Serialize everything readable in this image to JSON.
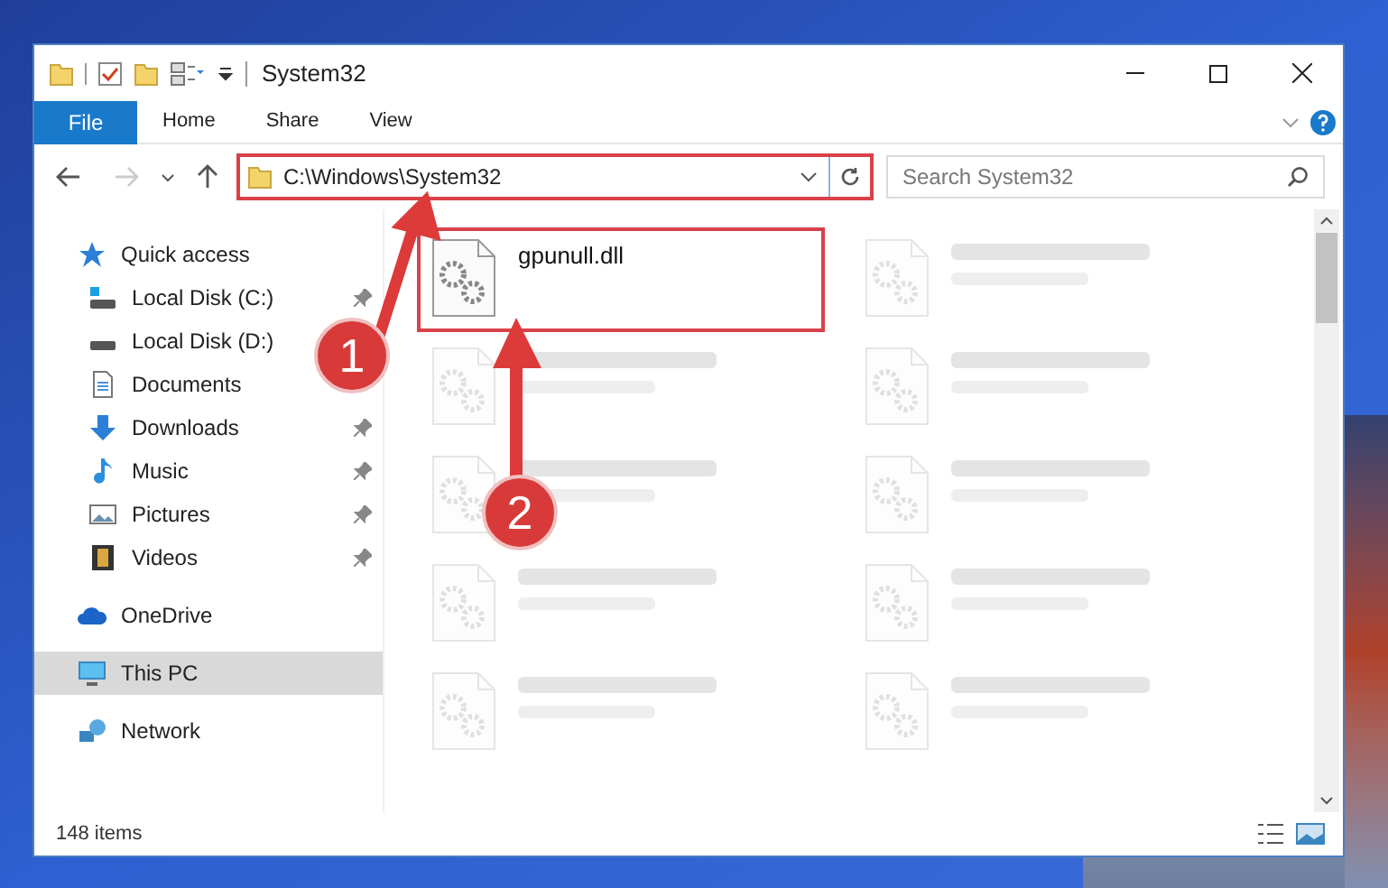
{
  "window": {
    "title": "System32"
  },
  "ribbon": {
    "tabs": [
      {
        "label": "File",
        "kind": "file"
      },
      {
        "label": "Home",
        "kind": "tab"
      },
      {
        "label": "Share",
        "kind": "tab"
      },
      {
        "label": "View",
        "kind": "tab"
      }
    ]
  },
  "address_bar": {
    "path": "C:\\Windows\\System32",
    "highlighted": true
  },
  "search": {
    "placeholder": "Search System32"
  },
  "sidebar": {
    "items": [
      {
        "label": "Quick access",
        "kind": "star",
        "selected": false,
        "children": [
          {
            "label": "Local Disk (C:)",
            "kind": "windows-drive",
            "pinned": true,
            "selected": false
          },
          {
            "label": "Local Disk (D:)",
            "kind": "drive",
            "pinned": false,
            "selected": false
          },
          {
            "label": "Documents",
            "kind": "documents",
            "pinned": false,
            "selected": false
          },
          {
            "label": "Downloads",
            "kind": "downloads",
            "pinned": true,
            "selected": false
          },
          {
            "label": "Music",
            "kind": "music",
            "pinned": true,
            "selected": false
          },
          {
            "label": "Pictures",
            "kind": "pictures",
            "pinned": true,
            "selected": false
          },
          {
            "label": "Videos",
            "kind": "videos",
            "pinned": true,
            "selected": false
          }
        ]
      },
      {
        "label": "OneDrive",
        "kind": "cloud",
        "selected": false
      },
      {
        "label": "This PC",
        "kind": "pc",
        "selected": true
      },
      {
        "label": "Network",
        "kind": "network",
        "selected": false
      }
    ]
  },
  "files": [
    {
      "kind": "file",
      "name": "gpunull.dll",
      "highlighted": true
    },
    {
      "kind": "blurred",
      "highlighted": false
    },
    {
      "kind": "blurred",
      "highlighted": false
    },
    {
      "kind": "blurred",
      "highlighted": false
    },
    {
      "kind": "blurred",
      "highlighted": false
    },
    {
      "kind": "blurred",
      "highlighted": false
    },
    {
      "kind": "blurred",
      "highlighted": false
    },
    {
      "kind": "blurred",
      "highlighted": false
    },
    {
      "kind": "blurred",
      "highlighted": false
    },
    {
      "kind": "blurred",
      "highlighted": false
    }
  ],
  "status_bar": {
    "item_count": "148 items"
  },
  "annotations": [
    {
      "number": "1"
    },
    {
      "number": "2"
    }
  ]
}
